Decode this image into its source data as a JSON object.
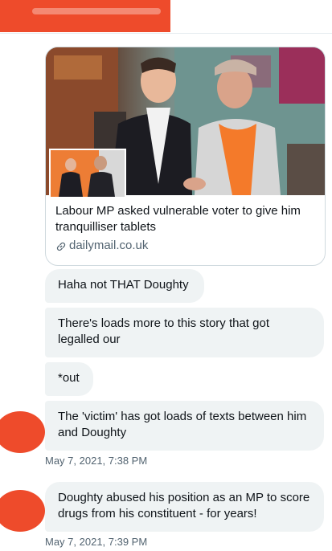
{
  "card": {
    "title": "Labour MP asked vulnerable voter to give him tranquilliser tablets",
    "domain": "dailymail.co.uk",
    "link_icon": "link-icon"
  },
  "messages": [
    {
      "text": "Haha not THAT Doughty"
    },
    {
      "text": "There's loads more to this story that got legalled our"
    },
    {
      "text": "*out"
    },
    {
      "text": "The 'victim' has got loads of texts between him and Doughty",
      "timestamp": "May 7, 2021, 7:38 PM"
    },
    {
      "text": "Doughty abused his position as an MP to score drugs from his constituent - for years!",
      "timestamp": "May 7, 2021, 7:39 PM"
    }
  ],
  "colors": {
    "bubble_bg": "#eff3f4",
    "redaction": "#ee4b2b",
    "secondary_text": "#536471"
  }
}
